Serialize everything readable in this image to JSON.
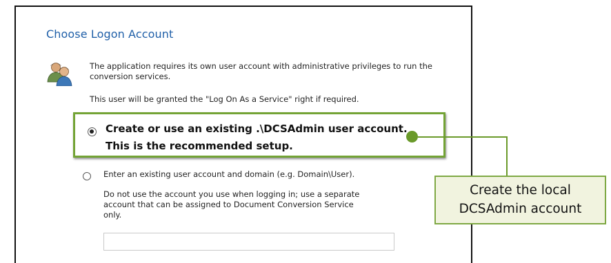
{
  "dialog": {
    "title": "Choose Logon Account",
    "description": "The application requires its own user account with administrative privileges to run the conversion services.",
    "privilege_note": "This user will be granted the \"Log On As a Service\" right if required.",
    "options": [
      {
        "line1": "Create or use an existing .\\DCSAdmin user account.",
        "line2": "This is the recommended setup.",
        "selected": true
      },
      {
        "label": "Enter an existing user account and domain (e.g. Domain\\User).",
        "note": "Do not use the account you use when logging in; use a separate account that can be assigned to Document Conversion Service only.",
        "selected": false
      }
    ],
    "account_input_value": ""
  },
  "callout": {
    "line1": "Create the local",
    "line2": "DCSAdmin account"
  },
  "colors": {
    "title": "#1f5fa8",
    "highlight_border": "#73a335",
    "callout_fill": "#f1f3df",
    "marker": "#6a9a2a"
  },
  "icons": {
    "users": "users-icon"
  }
}
